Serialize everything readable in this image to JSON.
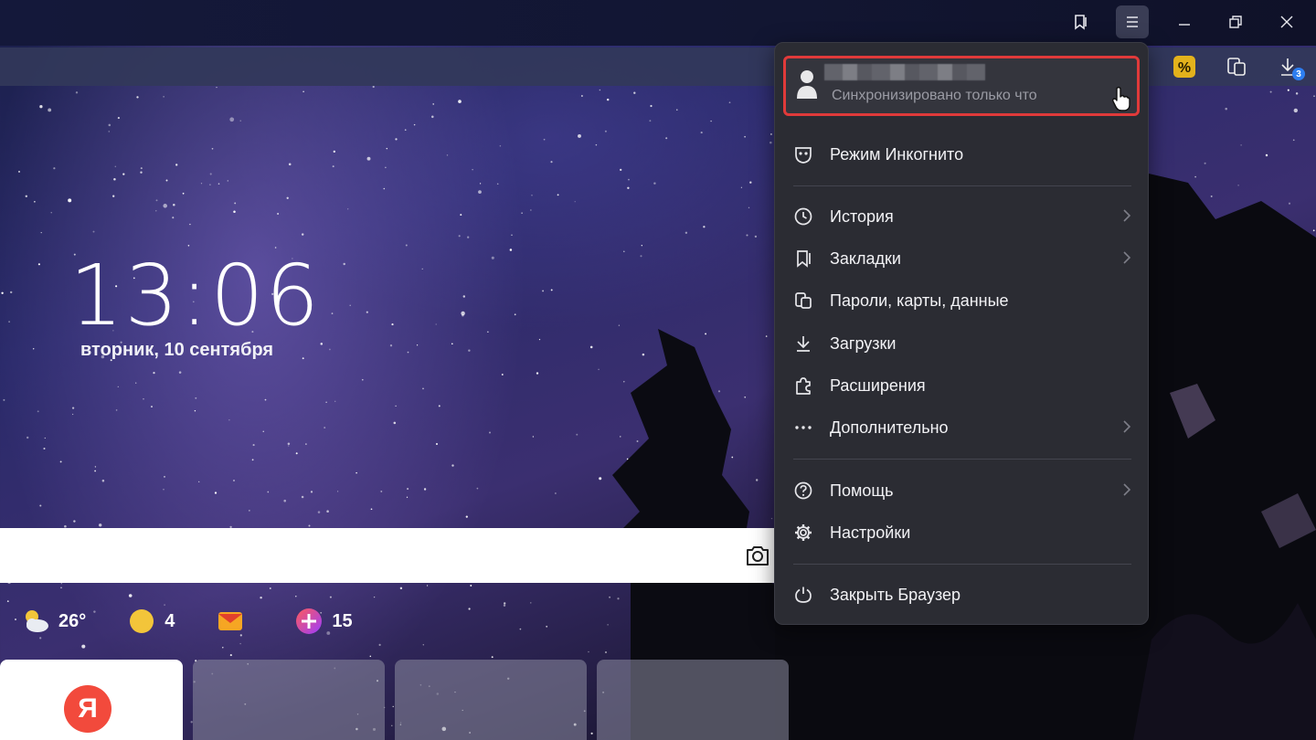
{
  "clock": {
    "time": "13:06",
    "date": "вторник, 10 сентября"
  },
  "widgets": [
    {
      "icon": "weather-cloud-sun-icon",
      "value": "26°"
    },
    {
      "icon": "traffic-icon",
      "value": "4"
    },
    {
      "icon": "mail-icon",
      "value": ""
    },
    {
      "icon": "plus-points-icon",
      "value": "15"
    }
  ],
  "toolbar": {
    "downloads_badge": "3"
  },
  "tiles": {
    "yandex_logo": "Я"
  },
  "menu": {
    "profile": {
      "sync_status": "Синхронизировано только что"
    },
    "items": [
      {
        "icon": "incognito-mask-icon",
        "label": "Режим Инкогнито",
        "submenu": false
      },
      {
        "icon": "history-clock-icon",
        "label": "История",
        "submenu": true
      },
      {
        "icon": "bookmarks-icon",
        "label": "Закладки",
        "submenu": true
      },
      {
        "icon": "passwords-cards-icon",
        "label": "Пароли, карты, данные",
        "submenu": false
      },
      {
        "icon": "download-icon",
        "label": "Загрузки",
        "submenu": false
      },
      {
        "icon": "extensions-puzzle-icon",
        "label": "Расширения",
        "submenu": false
      },
      {
        "icon": "more-dots-icon",
        "label": "Дополнительно",
        "submenu": true
      },
      {
        "icon": "help-question-icon",
        "label": "Помощь",
        "submenu": true
      },
      {
        "icon": "settings-gear-icon",
        "label": "Настройки",
        "submenu": false
      },
      {
        "icon": "power-icon",
        "label": "Закрыть Браузер",
        "submenu": false
      }
    ]
  },
  "colors": {
    "highlight": "#e03a3a",
    "menu_bg": "#2b2c33",
    "badge": "#2d7df0"
  }
}
